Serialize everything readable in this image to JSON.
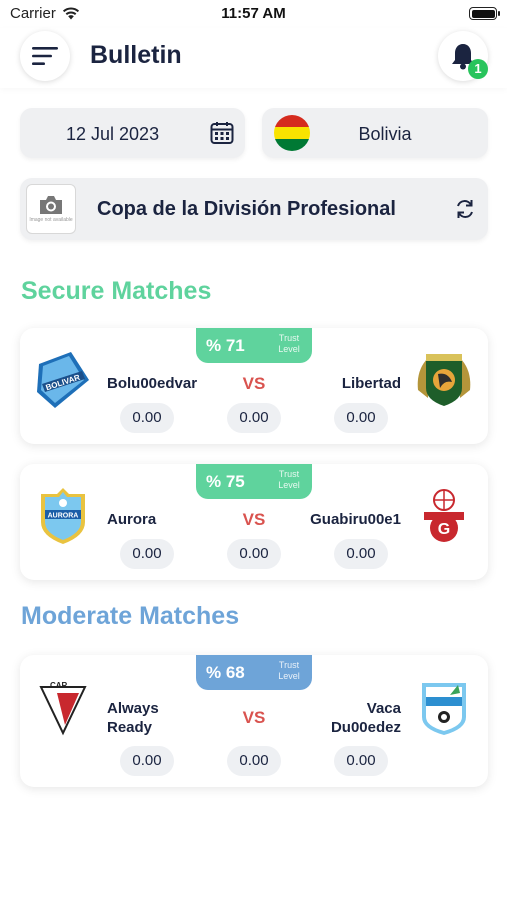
{
  "status_bar": {
    "carrier": "Carrier",
    "time": "11:57 AM"
  },
  "header": {
    "title": "Bulletin",
    "notification_count": "1",
    "menu_icon": "menu-icon",
    "bell_icon": "bell-icon"
  },
  "filters": {
    "date": "12 Jul 2023",
    "country": "Bolivia",
    "league": "Copa de la División Profesional",
    "league_image_placeholder": "Image not available"
  },
  "sections": {
    "secure_title": "Secure Matches",
    "moderate_title": "Moderate Matches"
  },
  "colors": {
    "secure": "#5fd39d",
    "moderate": "#6ea4d8",
    "vs": "#d9534f",
    "badge": "#28c45c"
  },
  "matches": [
    {
      "trust_pct": "% 71",
      "trust_label": "Trust Level",
      "home": "Bolu00edvar",
      "vs": "VS",
      "away": "Libertad",
      "odd1": "0.00",
      "oddx": "0.00",
      "odd2": "0.00"
    },
    {
      "trust_pct": "% 75",
      "trust_label": "Trust Level",
      "home": "Aurora",
      "vs": "VS",
      "away": "Guabiru00e1",
      "odd1": "0.00",
      "oddx": "0.00",
      "odd2": "0.00"
    },
    {
      "trust_pct": "% 68",
      "trust_label": "Trust Level",
      "home": "Always Ready",
      "vs": "VS",
      "away": "Vaca Du00edez",
      "odd1": "0.00",
      "oddx": "0.00",
      "odd2": "0.00"
    }
  ],
  "logo_texts": {
    "bolivar": "BOLIVAR",
    "aurora": "AURORA",
    "car": "CAR"
  }
}
